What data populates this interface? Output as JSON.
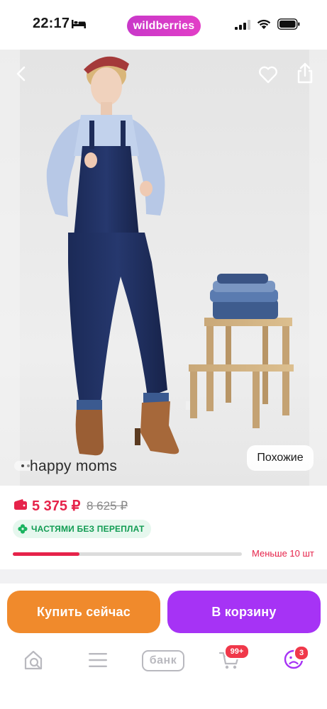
{
  "status_bar": {
    "time": "22:17",
    "brand": "wildberries"
  },
  "product": {
    "brand_label": "happy moms",
    "similar_label": "Похожие",
    "price": "5 375 ₽",
    "old_price": "8 625 ₽",
    "installment_label": "ЧАСТЯМИ БЕЗ ПЕРЕПЛАТ",
    "stock_text": "Меньше 10 шт",
    "stock_level": 0.29
  },
  "actions": {
    "buy_now_label": "Купить сейчас",
    "add_to_cart_label": "В корзину"
  },
  "tab_bar": {
    "bank_label": "банк",
    "cart_badge": "99+",
    "profile_badge": "3"
  },
  "colors": {
    "brand_gradient": [
      "#c938c9",
      "#e23ec7"
    ],
    "price_red": "#e6234a",
    "installment_green": "#119c53",
    "buy_now_orange": "#f08a2c",
    "add_to_cart_purple": "#a633f5",
    "badge_red": "#f0384a"
  },
  "icons": {
    "status": [
      "bed-icon",
      "signal-icon",
      "wifi-icon",
      "battery-icon"
    ],
    "hero": [
      "back-arrow-icon",
      "heart-icon",
      "share-icon"
    ],
    "tabs": [
      "home-search-icon",
      "catalog-menu-icon",
      "bank-icon",
      "cart-icon",
      "profile-icon"
    ]
  }
}
